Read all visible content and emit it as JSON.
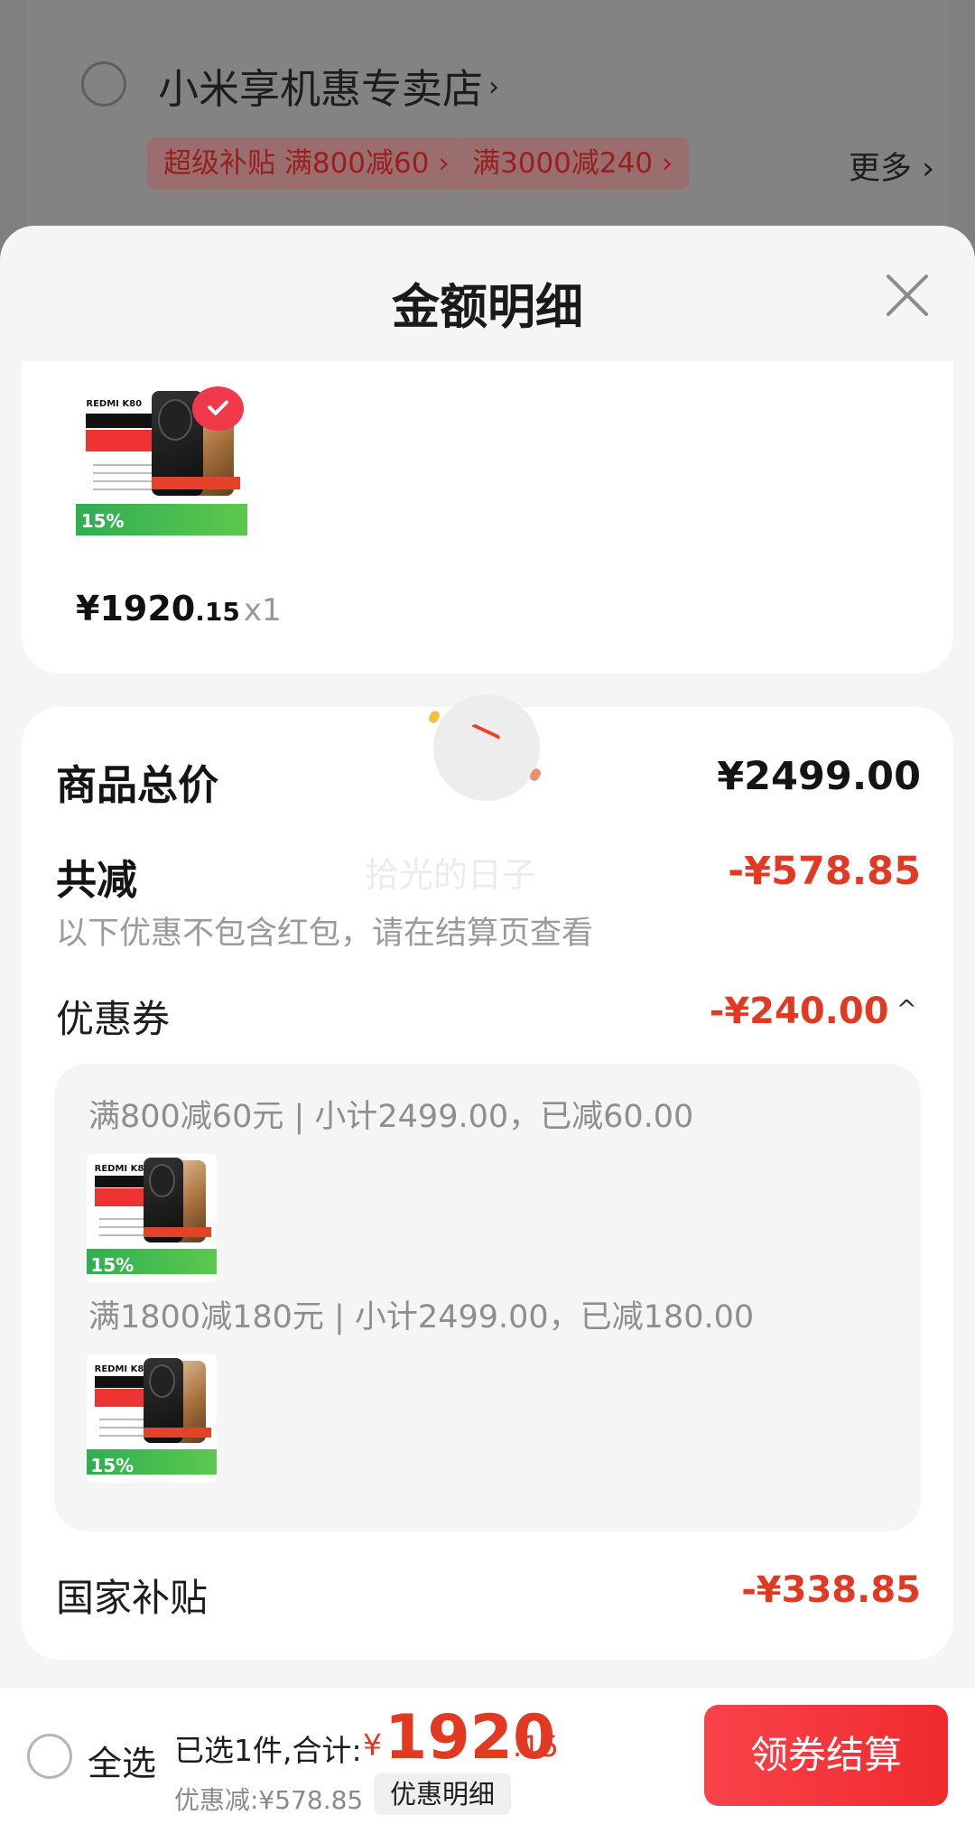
{
  "background": {
    "store_name": "小米享机惠专卖店",
    "store_chevron": "›",
    "tags": [
      "超级补贴 满800减60 ›",
      "满3000减240 ›"
    ],
    "more": "更多 ›"
  },
  "sheet": {
    "title": "金额明细",
    "close_icon": "close-icon"
  },
  "product": {
    "image_texts": {
      "brand": "REDMI K80",
      "percent": "15%"
    },
    "price_symbol": "¥",
    "price_int": "1920",
    "price_dec": ".15",
    "quantity": "x1"
  },
  "summary": {
    "total_label": "商品总价",
    "total_value": "¥2499.00",
    "reduce_label": "共减",
    "reduce_value": "-¥578.85",
    "watermark": "拾光的日子",
    "note": "以下优惠不包含红包，请在结算页查看",
    "coupon_label": "优惠券",
    "coupon_value": "-¥240.00",
    "coupon_caret": "^",
    "coupon_details": [
      "满800减60元 | 小计2499.00，已减60.00",
      "满1800减180元 | 小计2499.00，已减180.00"
    ],
    "gov_label": "国家补贴",
    "gov_value": "-¥338.85"
  },
  "bottom": {
    "select_all": "全选",
    "selected_text": "已选1件,合计:",
    "currency": "¥",
    "total_int": "1920",
    "total_dec": ".15",
    "discount_text": "优惠减:¥578.85",
    "detail_button": "优惠明细",
    "checkout_button": "领券结算"
  },
  "colors": {
    "accent_red": "#e23a22",
    "checkout_red": "#f8434a",
    "overlay_gray": "#7f7f7f"
  }
}
